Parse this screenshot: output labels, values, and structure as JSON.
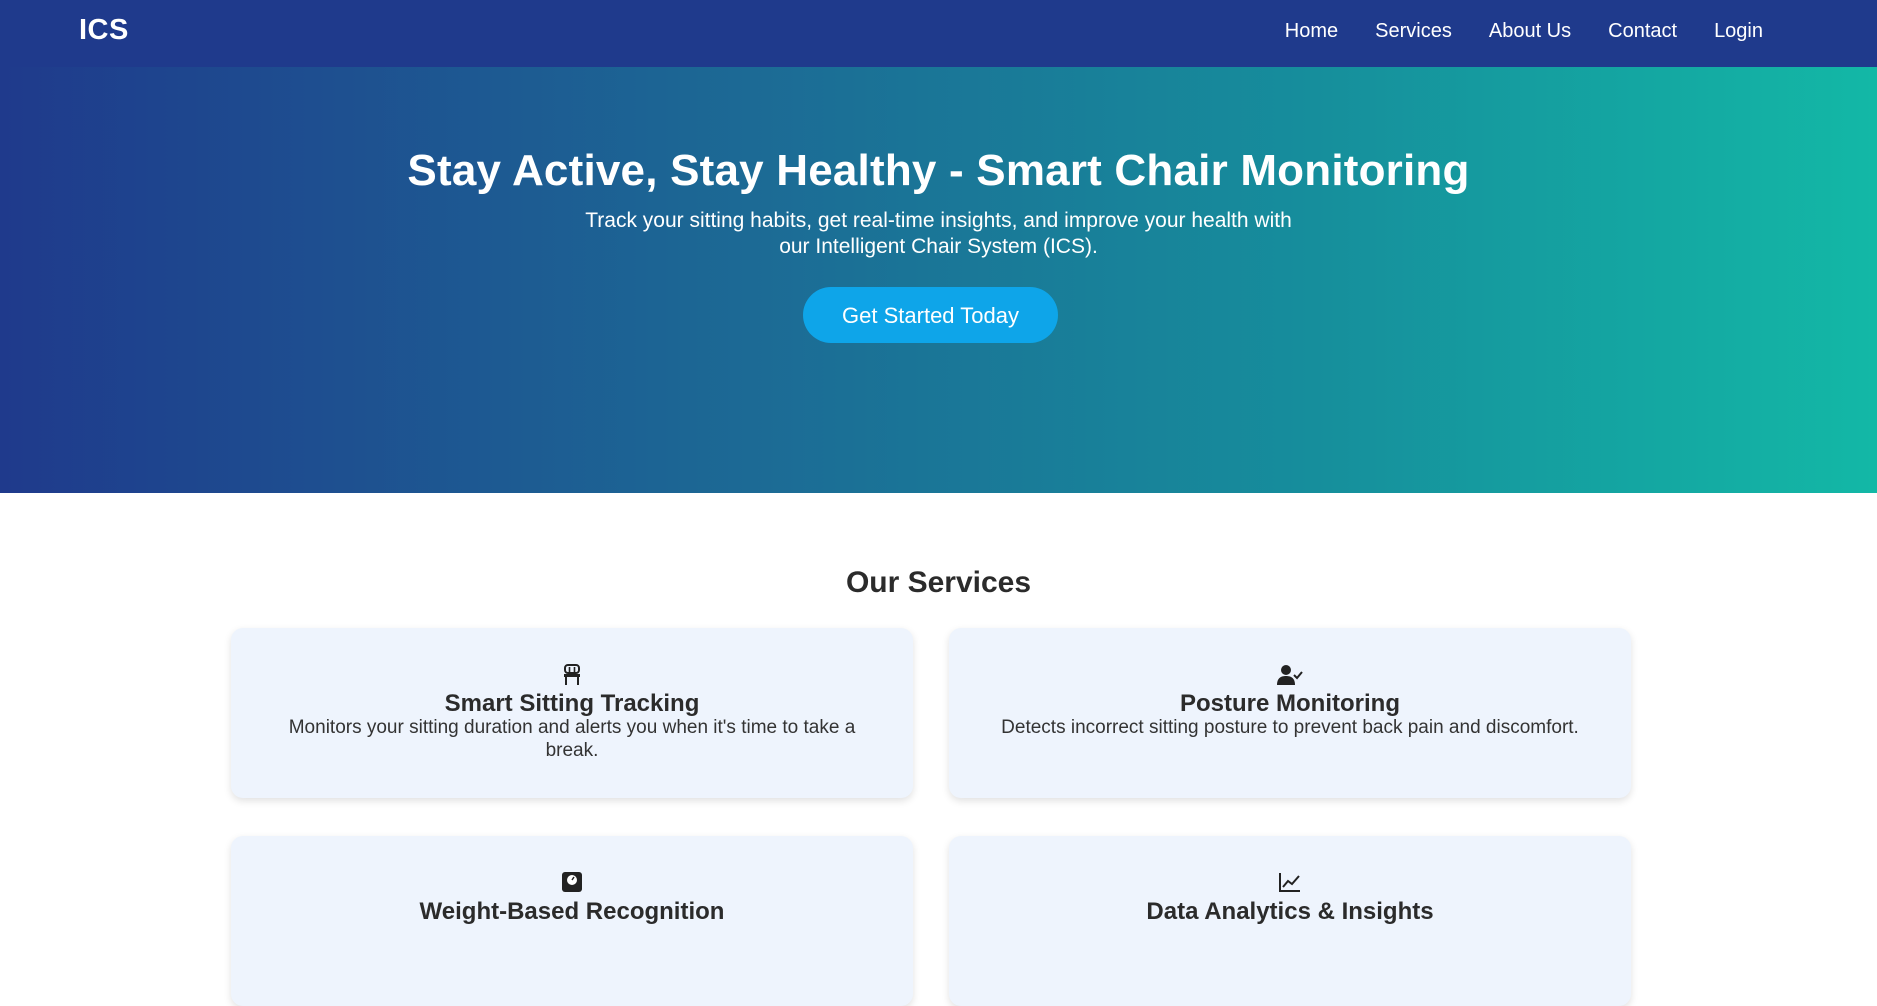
{
  "header": {
    "logo": "ICS",
    "nav": [
      "Home",
      "Services",
      "About Us",
      "Contact",
      "Login"
    ]
  },
  "hero": {
    "title": "Stay Active, Stay Healthy - Smart Chair Monitoring",
    "subtitle": "Track your sitting habits, get real-time insights, and improve your health with our Intelligent Chair System (ICS).",
    "cta_label": "Get Started Today"
  },
  "services": {
    "title": "Our Services",
    "items": [
      {
        "icon": "chair-icon",
        "title": "Smart Sitting Tracking",
        "description": "Monitors your sitting duration and alerts you when it's time to take a break."
      },
      {
        "icon": "user-check-icon",
        "title": "Posture Monitoring",
        "description": "Detects incorrect sitting posture to prevent back pain and discomfort."
      },
      {
        "icon": "weight-scale-icon",
        "title": "Weight-Based Recognition",
        "description": ""
      },
      {
        "icon": "chart-line-icon",
        "title": "Data Analytics & Insights",
        "description": ""
      }
    ]
  },
  "colors": {
    "header_bg": "#1f3a8c",
    "hero_gradient_start": "#1f3a8c",
    "hero_gradient_end": "#13b8a6",
    "cta_bg": "#0ea5e9",
    "card_bg": "#eef4fd"
  }
}
